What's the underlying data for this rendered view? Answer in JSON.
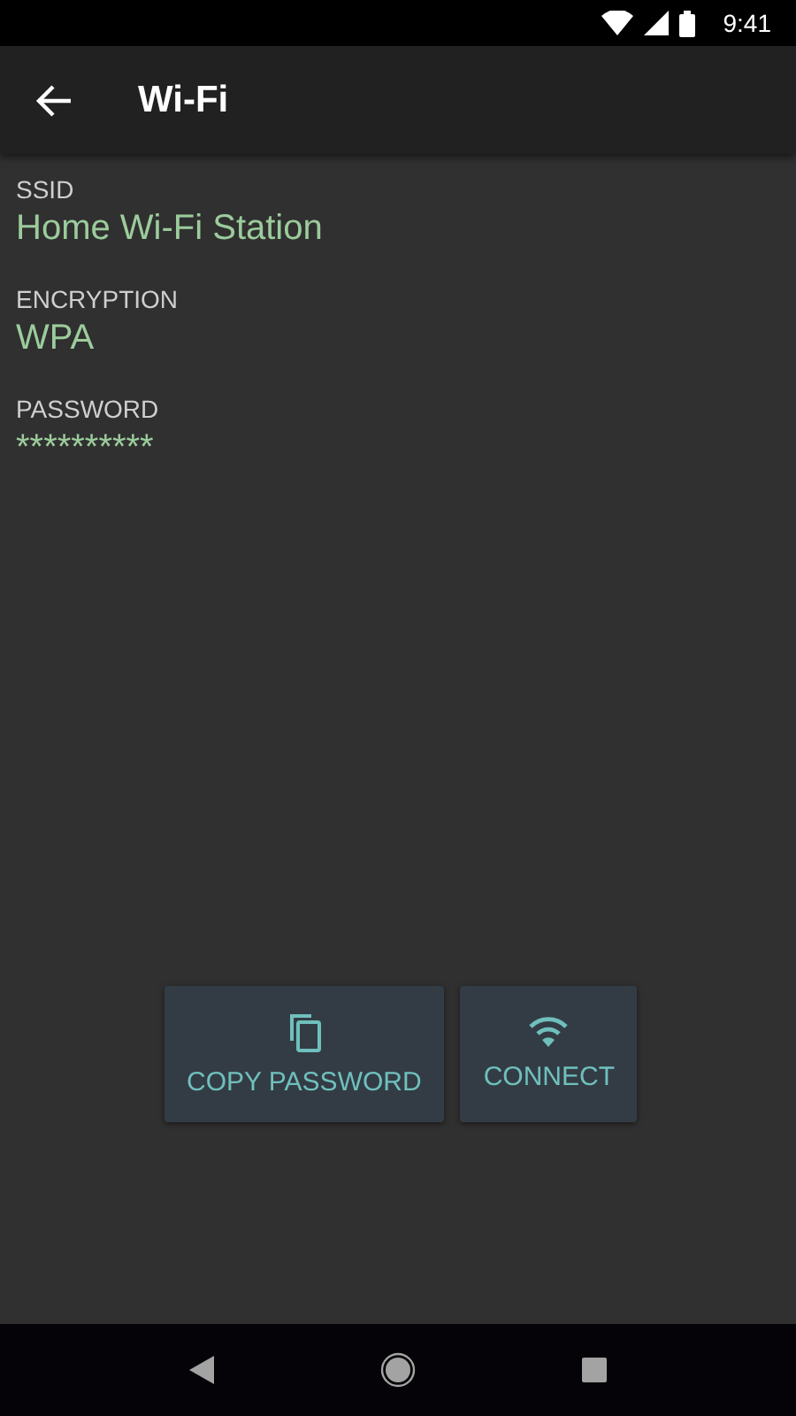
{
  "status_bar": {
    "time": "9:41"
  },
  "app_bar": {
    "title": "Wi-Fi"
  },
  "fields": [
    {
      "label": "SSID",
      "value": "Home Wi-Fi Station"
    },
    {
      "label": "ENCRYPTION",
      "value": "WPA"
    },
    {
      "label": "PASSWORD",
      "value": "**********"
    }
  ],
  "buttons": [
    {
      "kind": "copy",
      "label": "COPY PASSWORD"
    },
    {
      "kind": "wifi",
      "label": "CONNECT"
    }
  ]
}
